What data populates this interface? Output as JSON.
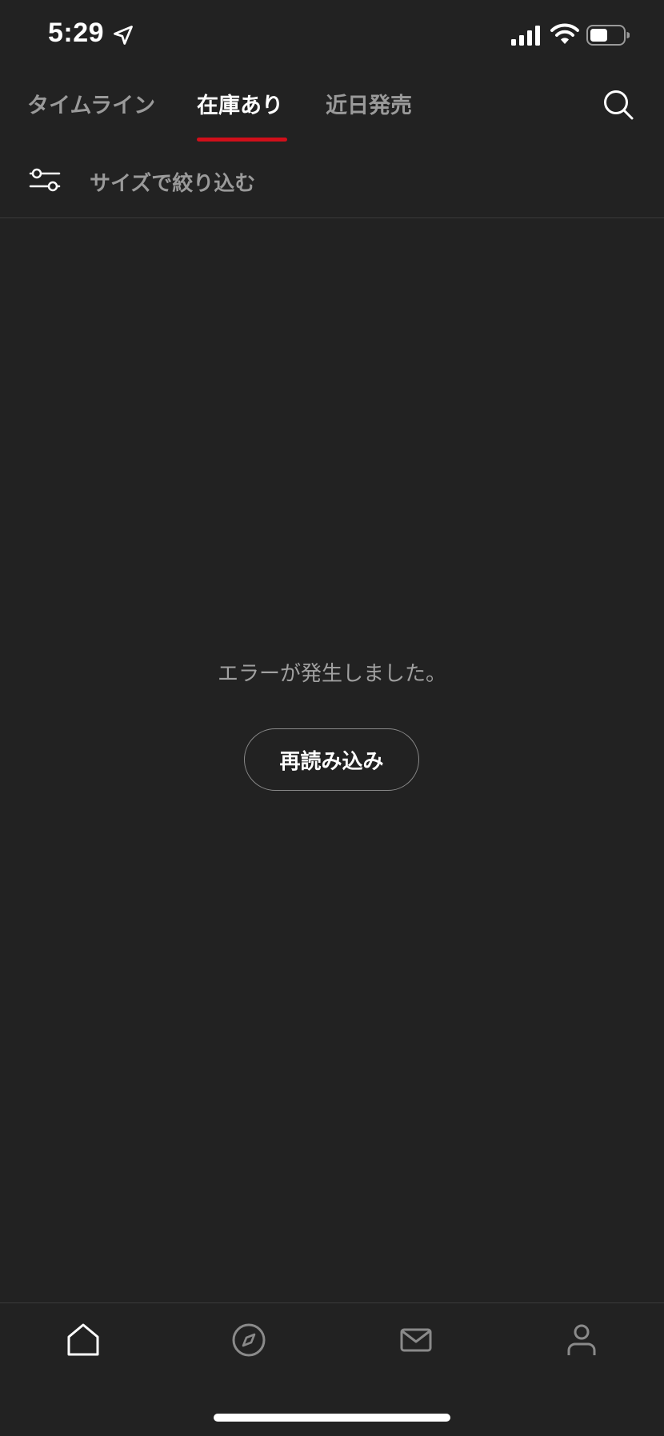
{
  "status_bar": {
    "time": "5:29",
    "icons": [
      "location-arrow-icon",
      "cellular-signal-icon",
      "wifi-icon",
      "battery-icon"
    ]
  },
  "tabs": [
    {
      "label": "タイムライン",
      "active": false
    },
    {
      "label": "在庫あり",
      "active": true
    },
    {
      "label": "近日発売",
      "active": false
    }
  ],
  "header": {
    "search_icon": "search-icon"
  },
  "filter": {
    "label": "サイズで絞り込む",
    "icon": "sliders-icon"
  },
  "error": {
    "message": "エラーが発生しました。",
    "reload_label": "再読み込み"
  },
  "bottom_nav": [
    {
      "icon": "home-icon",
      "active": true
    },
    {
      "icon": "compass-icon",
      "active": false
    },
    {
      "icon": "mail-icon",
      "active": false
    },
    {
      "icon": "person-icon",
      "active": false
    }
  ],
  "colors": {
    "background": "#222222",
    "accent": "#d10f1a",
    "text_primary": "#ffffff",
    "text_secondary": "#9a9a9a"
  }
}
